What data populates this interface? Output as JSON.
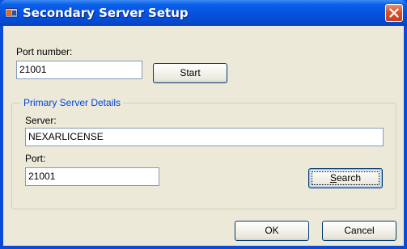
{
  "window": {
    "title": "Secondary Server Setup"
  },
  "port_number": {
    "label": "Port number:",
    "value": "21001"
  },
  "start_button": {
    "label": "Start"
  },
  "primary_server": {
    "group_title": "Primary Server Details",
    "server_label": "Server:",
    "server_value": "NEXARLICENSE",
    "port_label": "Port:",
    "port_value": "21001",
    "search_button": {
      "label_prefix": "",
      "label_accel": "S",
      "label_rest": "earch"
    }
  },
  "footer": {
    "ok_label": "OK",
    "cancel_label": "Cancel"
  },
  "icons": {
    "app": "app-icon",
    "close": "close-icon"
  },
  "colors": {
    "titlebar": "#0653df",
    "dialog_background": "#ece9d8",
    "group_title": "#0046d5",
    "close_button": "#d9512c"
  }
}
